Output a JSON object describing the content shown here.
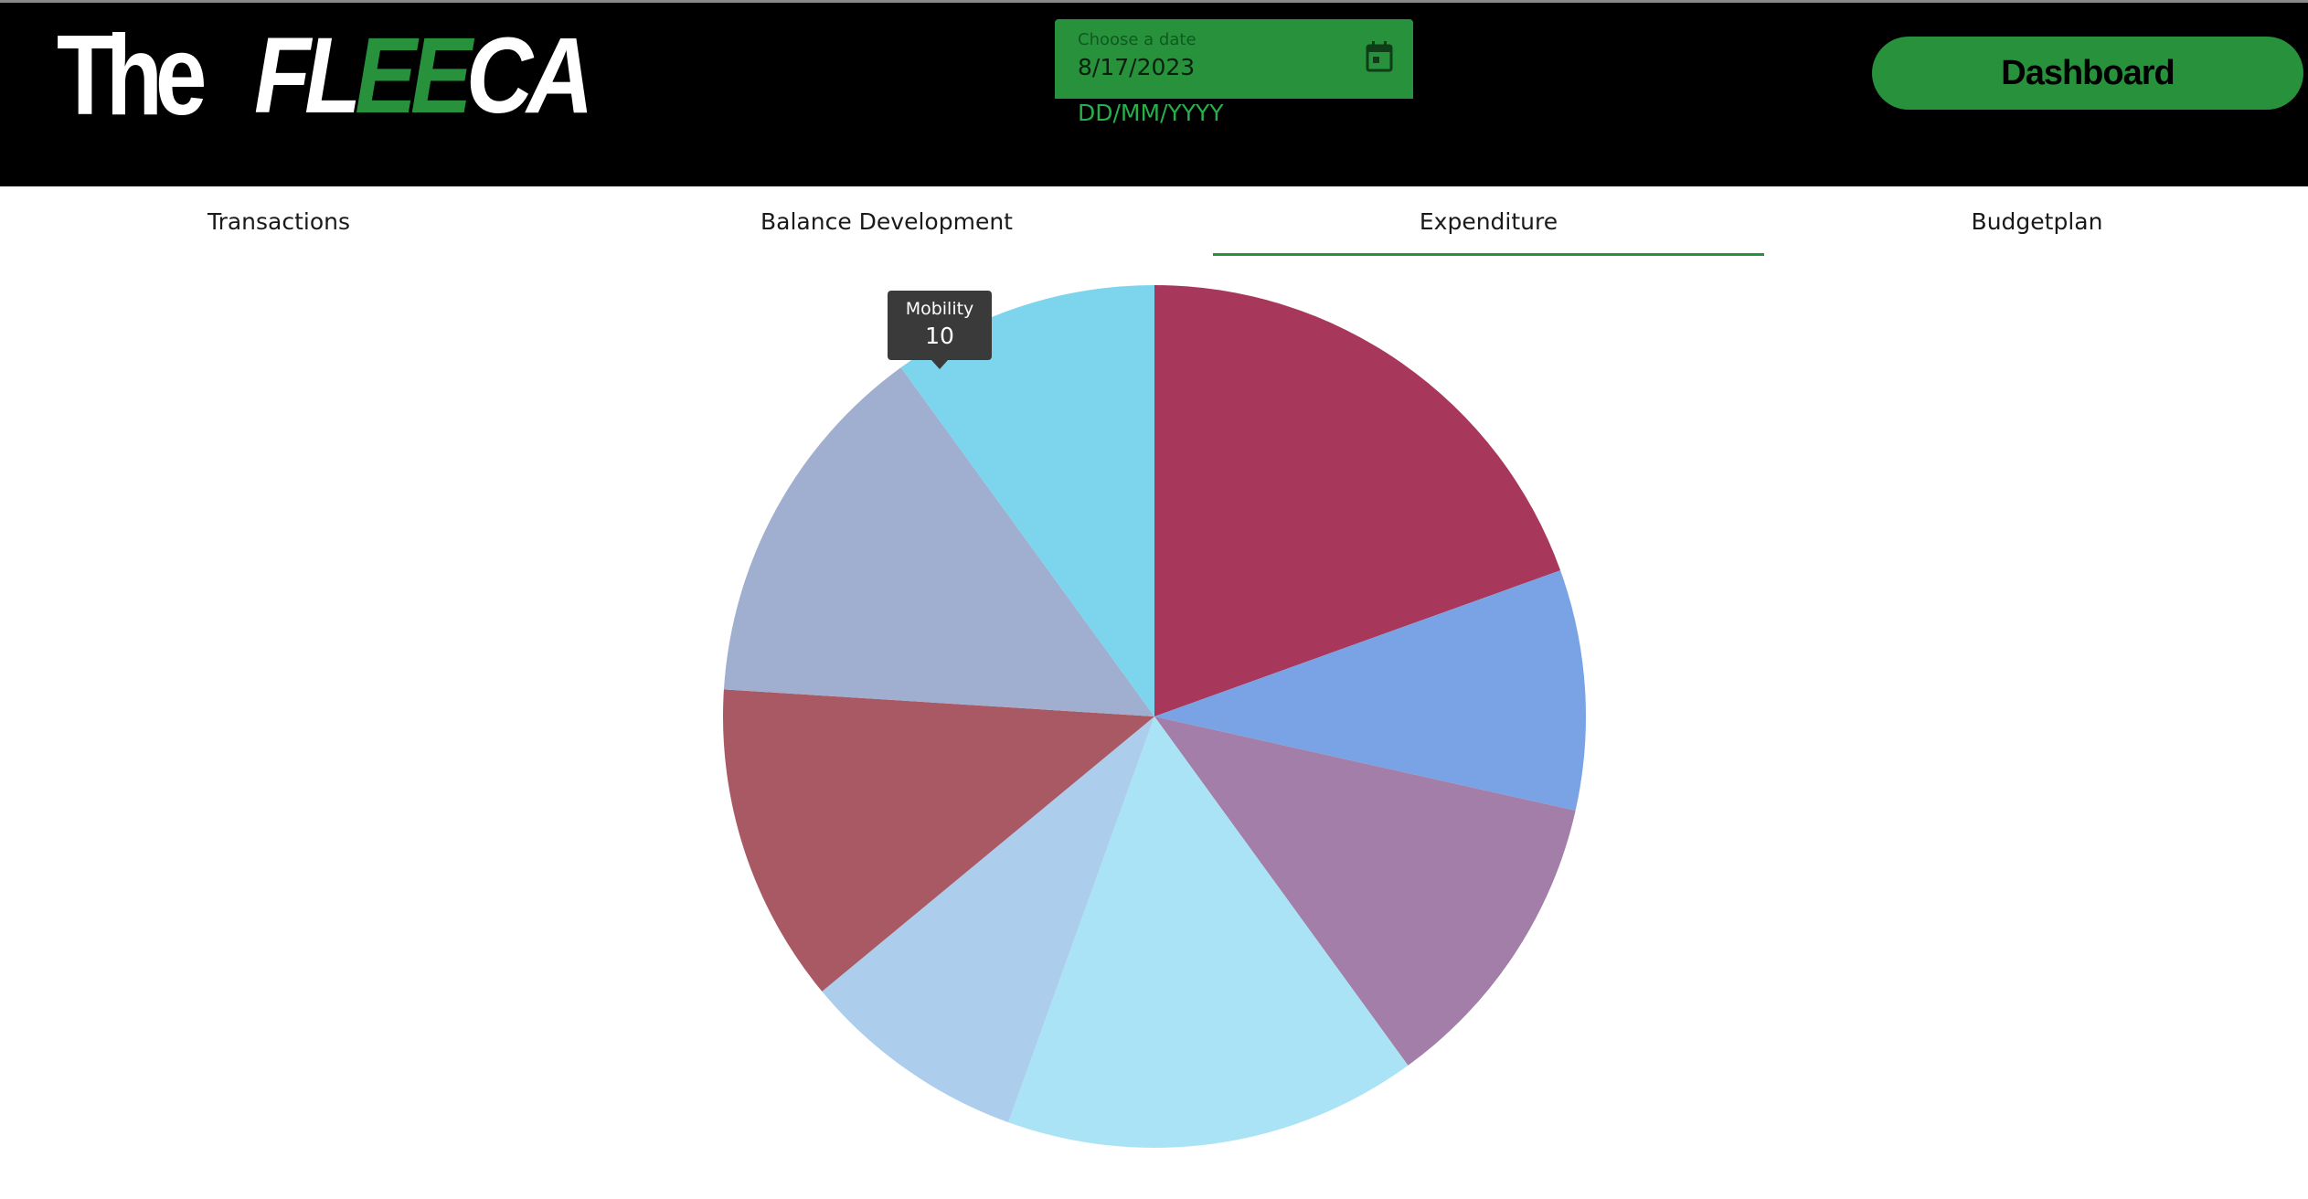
{
  "header": {
    "logo": {
      "the": "The",
      "fl": "FL",
      "ee": "EE",
      "ca": "CA"
    },
    "date_field": {
      "label": "Choose a date",
      "value": "8/17/2023",
      "hint": "DD/MM/YYYY",
      "icon": "calendar-icon"
    },
    "dashboard_button": "Dashboard"
  },
  "tabs": [
    {
      "label": "Transactions",
      "active": false
    },
    {
      "label": "Balance Development",
      "active": false
    },
    {
      "label": "Expenditure",
      "active": true
    },
    {
      "label": "Budgetplan",
      "active": false
    }
  ],
  "tooltip": {
    "label": "Mobility",
    "value": "10"
  },
  "colors": {
    "accent": "#27913b",
    "header_bg": "#000000",
    "hint": "#27b04a"
  },
  "chart_data": {
    "type": "pie",
    "start_angle_deg": 0,
    "direction": "clockwise",
    "slices": [
      {
        "value": 19.5,
        "color": "#a8375c"
      },
      {
        "value": 9,
        "color": "#7aa3e5"
      },
      {
        "value": 11.5,
        "color": "#a27ea8"
      },
      {
        "value": 15.5,
        "color": "#aae3f5"
      },
      {
        "value": 8.5,
        "color": "#adcded"
      },
      {
        "value": 12,
        "color": "#a95963"
      },
      {
        "value": 14,
        "color": "#a0aed0"
      },
      {
        "name": "Mobility",
        "value": 10,
        "color": "#7dd4ed"
      }
    ]
  }
}
